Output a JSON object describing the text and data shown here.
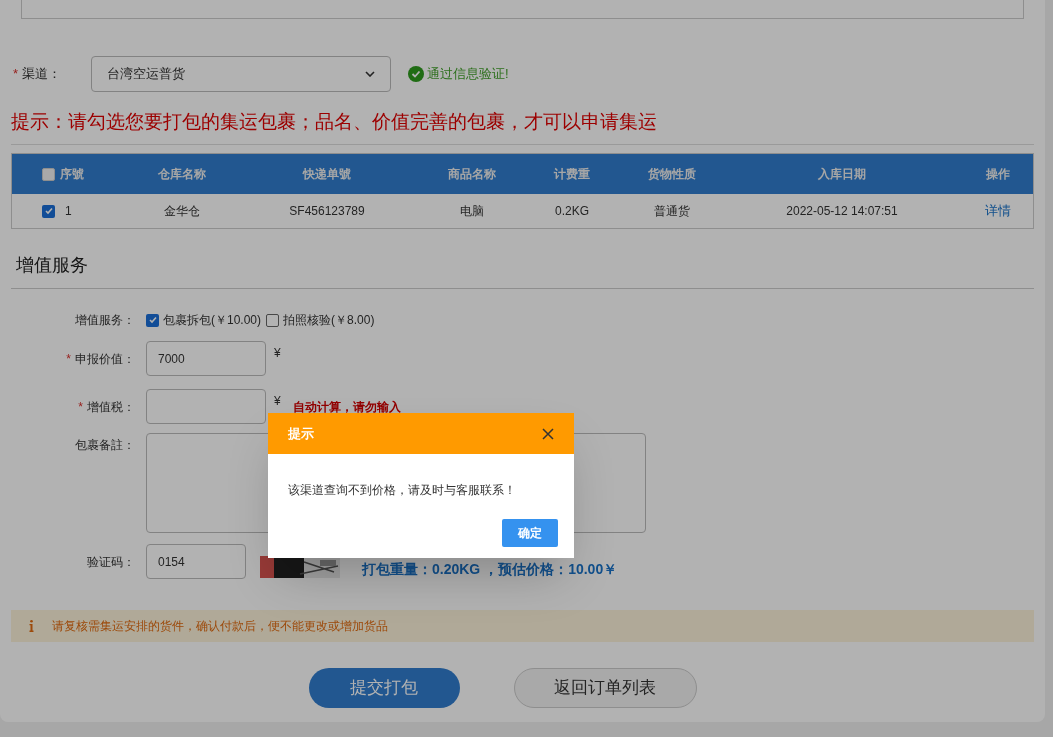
{
  "channel": {
    "label": "渠道：",
    "required_mark": "*",
    "value": "台湾空运普货",
    "verified_text": "通过信息验证!"
  },
  "hint": "提示：请勾选您要打包的集运包裹；品名、价值完善的包裹，才可以申请集运",
  "table": {
    "select_all": {
      "checked": false
    },
    "columns": [
      "序號",
      "仓库名称",
      "快递单號",
      "商品名称",
      "计费重",
      "货物性质",
      "入库日期",
      "操作"
    ],
    "rows": [
      {
        "selected": true,
        "cells": [
          "1",
          "金华仓",
          "SF456123789",
          "电脑",
          "0.2KG",
          "普通货",
          "2022-05-12 14:07:51"
        ],
        "action": "详情"
      }
    ]
  },
  "section_title": "增值服务",
  "services": {
    "label": "增值服务：",
    "options": [
      {
        "label": "包裹拆包(￥10.00)",
        "checked": true
      },
      {
        "label": "拍照核验(￥8.00)",
        "checked": false
      }
    ]
  },
  "declared_value": {
    "label": "申报价值：",
    "required_mark": "*",
    "value": "7000",
    "unit": "¥"
  },
  "vat": {
    "label": "增值税：",
    "required_mark": "*",
    "unit": "¥",
    "note": "自动计算，请勿输入"
  },
  "remark": {
    "label": "包裹备註："
  },
  "captcha": {
    "label": "验证码：",
    "value": "0154"
  },
  "summary": {
    "label": "打包重量：0.20KG ，预估价格：",
    "price": "10.00￥"
  },
  "notice": "请复核需集运安排的货件，确认付款后，便不能更改或增加货品",
  "buttons": [
    {
      "label": "提交打包",
      "kind": "primary"
    },
    {
      "label": "返回订单列表",
      "kind": "secondary"
    }
  ],
  "dialog": {
    "title": "提示",
    "message": "该渠道查询不到价格，请及时与客服联系！",
    "confirm": "确定"
  }
}
